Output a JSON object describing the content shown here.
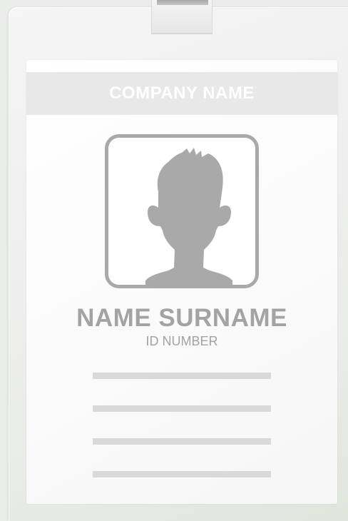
{
  "badge": {
    "company_name": "COMPANY NAME",
    "name": "NAME SURNAME",
    "id_number": "ID NUMBER",
    "photo": "user-silhouette-icon",
    "placeholder_lines": 4
  },
  "colors": {
    "header": "#e8e8e8",
    "text": "#a3a3a3",
    "silhouette": "#a9a9a9",
    "lines": "#d9d9d9"
  }
}
